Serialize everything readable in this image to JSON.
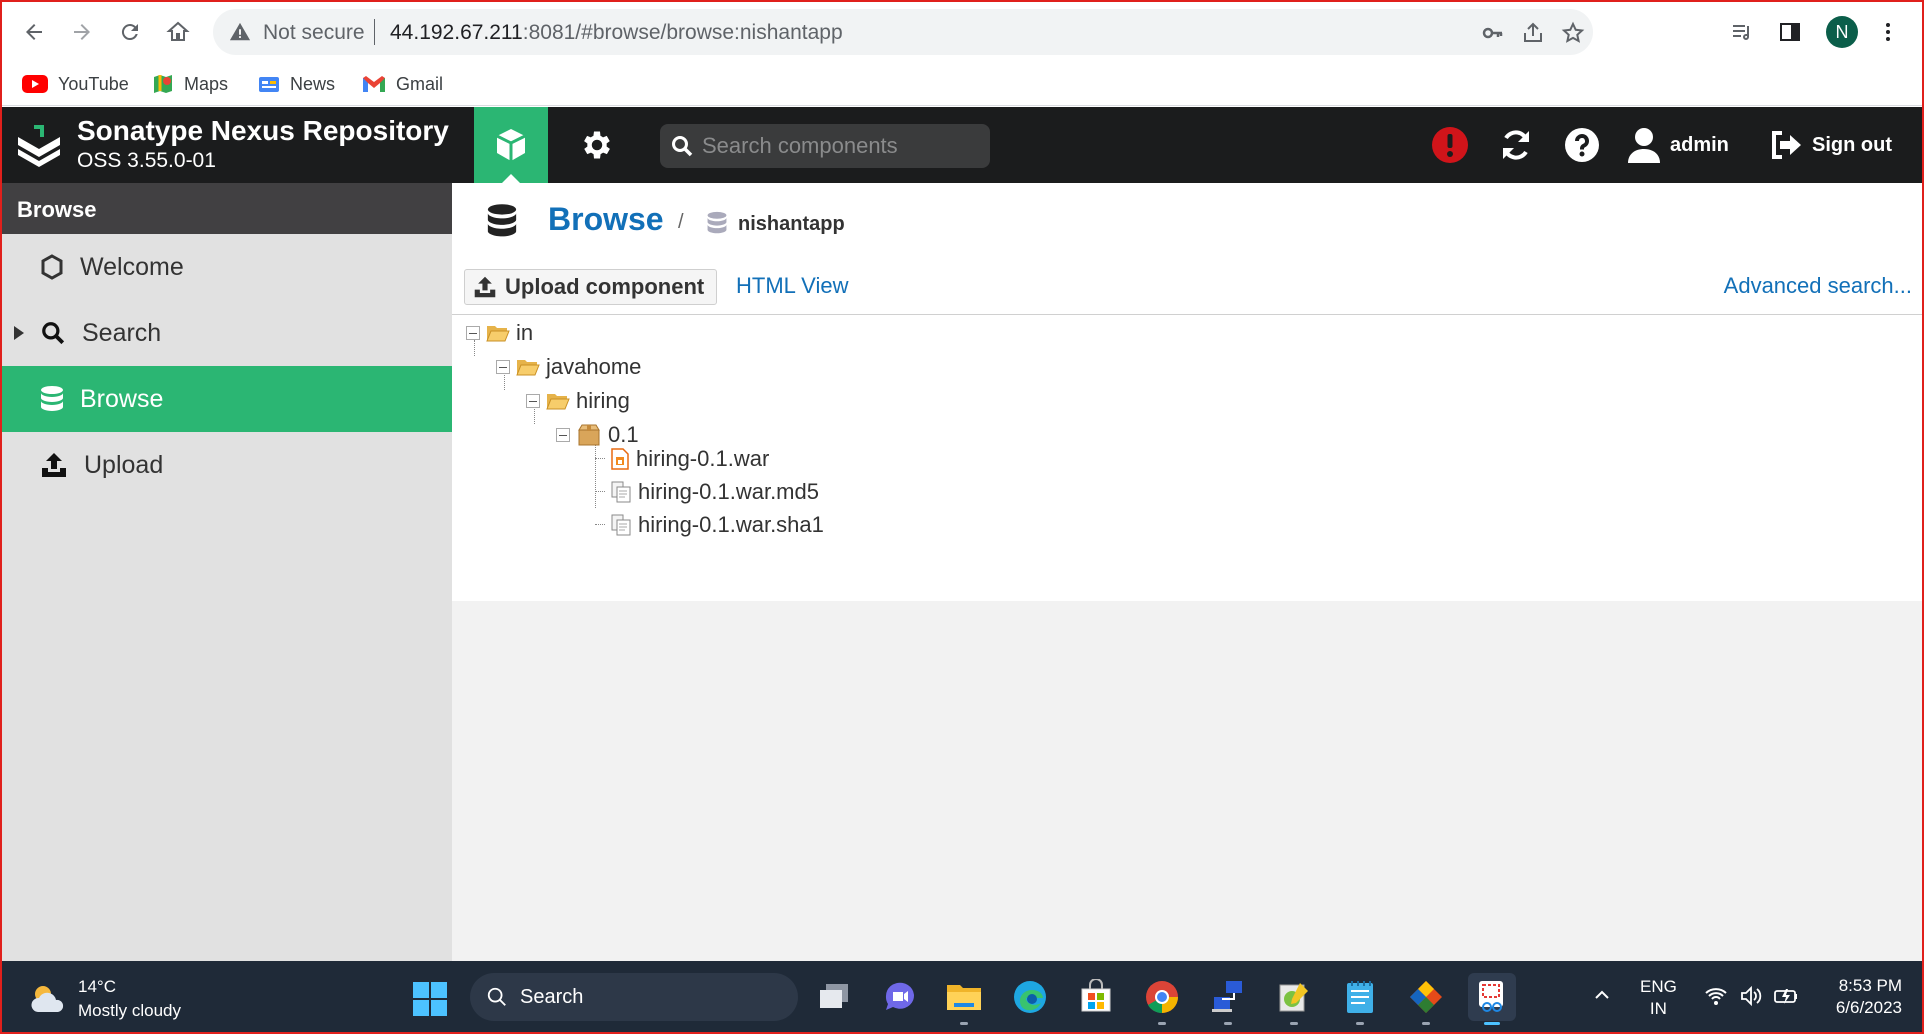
{
  "browser": {
    "not_secure": "Not secure",
    "url_host": "44.192.67.211",
    "url_rest": ":8081/#browse/browse:nishantapp",
    "profile_initial": "N",
    "bookmarks": [
      {
        "label": "YouTube",
        "icon": "youtube-icon"
      },
      {
        "label": "Maps",
        "icon": "maps-icon"
      },
      {
        "label": "News",
        "icon": "news-icon"
      },
      {
        "label": "Gmail",
        "icon": "gmail-icon"
      }
    ]
  },
  "nexus": {
    "title": "Sonatype Nexus Repository",
    "version": "OSS 3.55.0-01",
    "search_placeholder": "Search components",
    "user": "admin",
    "sign_out": "Sign out",
    "accent_color": "#2bb673",
    "header_color": "#1b1c1d"
  },
  "sidebar": {
    "header": "Browse",
    "items": [
      {
        "label": "Welcome",
        "icon": "hexagon-icon"
      },
      {
        "label": "Search",
        "icon": "search-icon"
      },
      {
        "label": "Browse",
        "icon": "database-icon",
        "active": true
      },
      {
        "label": "Upload",
        "icon": "upload-icon"
      }
    ]
  },
  "main": {
    "breadcrumb_title": "Browse",
    "breadcrumb_sep": "/",
    "repository": "nishantapp",
    "upload_button": "Upload component",
    "html_view": "HTML View",
    "advanced_search": "Advanced search...",
    "tree": [
      {
        "label": "in",
        "level": 0,
        "icon": "folder-open-icon"
      },
      {
        "label": "javahome",
        "level": 1,
        "icon": "folder-open-icon"
      },
      {
        "label": "hiring",
        "level": 2,
        "icon": "folder-open-icon"
      },
      {
        "label": "0.1",
        "level": 3,
        "icon": "package-icon"
      },
      {
        "label": "hiring-0.1.war",
        "level": 4,
        "icon": "war-file-icon"
      },
      {
        "label": "hiring-0.1.war.md5",
        "level": 4,
        "icon": "file-copy-icon"
      },
      {
        "label": "hiring-0.1.war.sha1",
        "level": 4,
        "icon": "file-copy-icon"
      }
    ]
  },
  "taskbar": {
    "temperature": "14°C",
    "weather": "Mostly cloudy",
    "search": "Search",
    "lang": "ENG",
    "region": "IN",
    "time": "8:53 PM",
    "date": "6/6/2023"
  }
}
